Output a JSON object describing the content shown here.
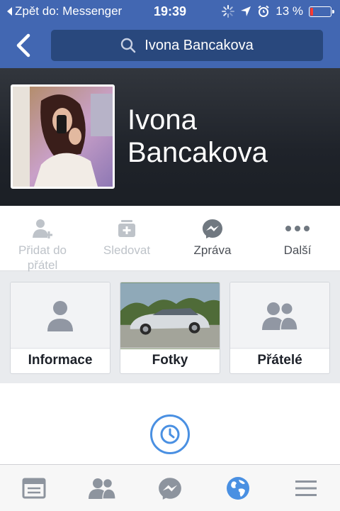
{
  "status_bar": {
    "back_app": "Zpět do: Messenger",
    "time": "19:39",
    "battery_percent_text": "13 %",
    "battery_level": 0.13,
    "battery_color": "#ff3b30"
  },
  "nav": {
    "search_text": "Ivona Bancakova"
  },
  "profile": {
    "name_line1": "Ivona",
    "name_line2": "Bancakova"
  },
  "actions": [
    {
      "label": "Přidat do přátel",
      "icon": "add-friend-icon"
    },
    {
      "label": "Sledovat",
      "icon": "follow-icon"
    },
    {
      "label": "Zpráva",
      "icon": "messenger-icon"
    },
    {
      "label": "Další",
      "icon": "more-icon"
    }
  ],
  "tiles": [
    {
      "label": "Informace",
      "icon": "person-icon"
    },
    {
      "label": "Fotky",
      "icon": "photo-thumbnail"
    },
    {
      "label": "Přátelé",
      "icon": "friends-icon"
    }
  ],
  "tabs": [
    {
      "name": "news-feed",
      "icon": "news-feed-icon"
    },
    {
      "name": "friends",
      "icon": "friends-icon"
    },
    {
      "name": "messenger",
      "icon": "messenger-icon"
    },
    {
      "name": "notifications",
      "icon": "globe-icon",
      "active": true
    },
    {
      "name": "more",
      "icon": "menu-icon"
    }
  ],
  "colors": {
    "brand": "#4267b2",
    "accent": "#4a90e2",
    "muted_icon": "#8d949e"
  }
}
